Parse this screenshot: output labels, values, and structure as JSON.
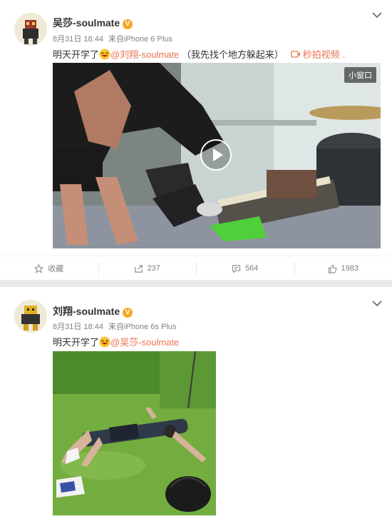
{
  "post1": {
    "author": "吴莎-soulmate",
    "date": "8月31日 18:44",
    "via": "来自",
    "device": "iPhone 6 Plus",
    "text_prefix": "明天开学了",
    "mention": "@刘翔-soulmate",
    "text_suffix": "（我先找个地方躲起来）",
    "video_link": "秒拍视频",
    "video_link_dot": ".",
    "mini_window": "小窗口",
    "actions": {
      "favorite": "收藏",
      "repost": "237",
      "comment": "564",
      "like": "1983"
    }
  },
  "post2": {
    "author": "刘翔-soulmate",
    "date": "8月31日 18:44",
    "via": "来自",
    "device": "iPhone 6s Plus",
    "text_prefix": "明天开学了",
    "mention": "@吴莎-soulmate"
  },
  "colors": {
    "link": "#eb7350",
    "verified": "#f5a623",
    "meta": "#808080",
    "page_bg": "#eaeaea"
  },
  "icons": [
    "verified-badge-icon",
    "chevron-down-icon",
    "laugh-emoji-icon",
    "video-icon",
    "play-icon",
    "star-icon",
    "repost-icon",
    "comment-icon",
    "thumbs-up-icon"
  ]
}
